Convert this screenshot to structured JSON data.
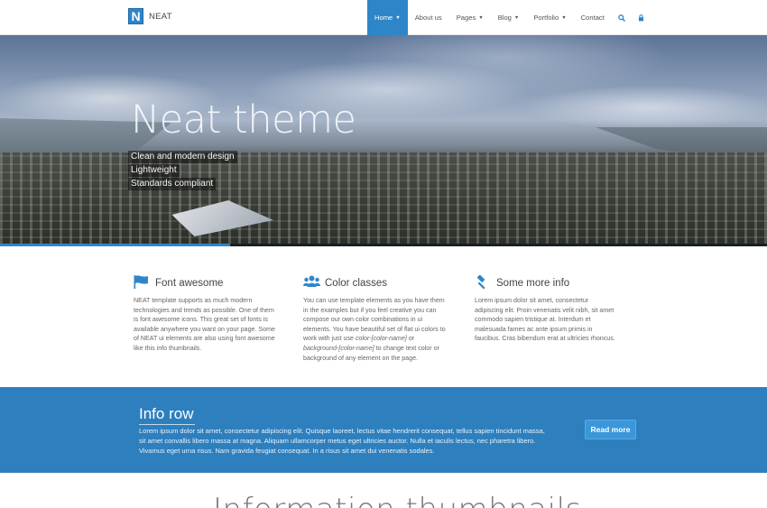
{
  "navbar": {
    "brand_letter": "N",
    "brand_name": "NEAT",
    "items": [
      {
        "label": "Home",
        "has_caret": true,
        "active": true
      },
      {
        "label": "About us",
        "has_caret": false,
        "active": false
      },
      {
        "label": "Pages",
        "has_caret": true,
        "active": false
      },
      {
        "label": "Blog",
        "has_caret": true,
        "active": false
      },
      {
        "label": "Portfolio",
        "has_caret": true,
        "active": false
      },
      {
        "label": "Contact",
        "has_caret": false,
        "active": false
      }
    ],
    "icons": [
      "search-icon",
      "lock-icon"
    ]
  },
  "hero": {
    "title": "Neat theme",
    "taglines": [
      "Clean and modern design",
      "Lightweight",
      "Standards compliant"
    ],
    "slide_progress": 0.3
  },
  "features": [
    {
      "icon": "flag-icon",
      "title": "Font awesome",
      "text": "NEAT template supports as much modern technologies and trends as possible. One of them is font awesome icons. This great set of fonts is available anywhere you want on your page. Some of NEAT ui elements are also using font awesome like this info thumbnails."
    },
    {
      "icon": "users-icon",
      "title": "Color classes",
      "text_before": "You can use template elements as you have them in the examples but if you feel creative you can compose our own color combinations in ui elements. You have beautiful set of flat ui colors to work with just use ",
      "code1": "color-[color-name]",
      "text_middle": " or ",
      "code2": "background-[color-name]",
      "text_after": " to change text color or background of any element on the page."
    },
    {
      "icon": "gavel-icon",
      "title": "Some more info",
      "text": "Lorem ipsum dolor sit amet, consectetur adipiscing elit. Proin venenatis velit nibh, sit amet commodo sapien tristique at. Interdum et malesuada fames ac ante ipsum primis in faucibus. Cras bibendum erat at ultricies rhoncus."
    }
  ],
  "info_row": {
    "title": "Info row",
    "text": "Lorem ipsum dolor sit amet, consectetur adipiscing elit. Quisque laoreet, lectus vitae hendrerit consequat, tellus sapien tincidunt massa, sit amet convallis libero massa at magna. Aliquam ullamcorper metus eget ultricies auctor. Nulla et iaculis lectus, nec pharetra libero. Vivamus eget urna risus. Nam gravida feugiat consequat. In a risus sit amet dui venenatis sodales.",
    "button_label": "Read more"
  },
  "bottom_heading": "Information thumbnails",
  "colors": {
    "accent": "#2e86c9",
    "info_row_bg": "#2e7fbe",
    "button_bg": "#3b97da"
  }
}
